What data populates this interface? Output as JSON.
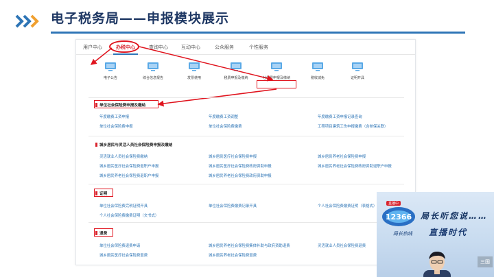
{
  "slide": {
    "title": "电子税务局——申报模块展示"
  },
  "nav": {
    "items": [
      "用户中心",
      "办税中心",
      "查询中心",
      "互动中心",
      "公众服务",
      "个性服务"
    ],
    "active_index": 1
  },
  "functions": {
    "items": [
      "电子公告",
      "综合信息报告",
      "发票使用",
      "税费申报及缴纳",
      "社保费申报及缴纳",
      "税收减免",
      "证明开具"
    ],
    "highlighted_index": 4
  },
  "sections": {
    "unit": {
      "title": "单位社会保险费申报及缴纳",
      "links": [
        "年度缴费工资申报",
        "年度缴费工资调整",
        "年度缴费工资申报记录查询",
        "单位社会保险费申报",
        "单位社会保险费缴费",
        "工程项目建筑工伤申报缴费（含参保关联）"
      ]
    },
    "resident": {
      "title": "城乡居民与灵活人员社会保险费申报及缴纳",
      "links": [
        "灵活就业人员社会保险费缴纳",
        "城乡居民医疗社会保险费申报",
        "城乡居民养老社会保险费申报",
        "城乡居民医疗社会保险费退职户申报",
        "城乡居民医疗社会保险费政府资助申报",
        "城乡居民养老社会保险费政府资助退职户申报",
        "城乡居民养老社会保险费退职户申报",
        "城乡居民养老社会保险费政府资助申报"
      ]
    },
    "proof": {
      "title": "证明",
      "links": [
        "单位社会保险费完税证明开具",
        "单位社会保险费缴费记录开具",
        "个人社会保险费缴费证明（表格式）",
        "个人社会保险费缴费证明（文书式）"
      ]
    },
    "refund": {
      "title": "退费",
      "links": [
        "单位社会保险费退费申请",
        "城乡居民养老社会保险费集体补助与政府资助退费",
        "灵活就业人员社会保险费退费",
        "城乡居民医疗社会保险费退费",
        "城乡居民养老社会保险费退费"
      ]
    }
  },
  "video": {
    "title": "局长听您说……",
    "title2": "直播时代",
    "subtitle": "局长热线",
    "live_tag": "直播中",
    "logo_text": "12366",
    "watermark": "三国"
  },
  "colors": {
    "accent": "#2e75b6",
    "title": "#1f3864",
    "highlight": "#e0141e",
    "link": "#2e75b6"
  }
}
